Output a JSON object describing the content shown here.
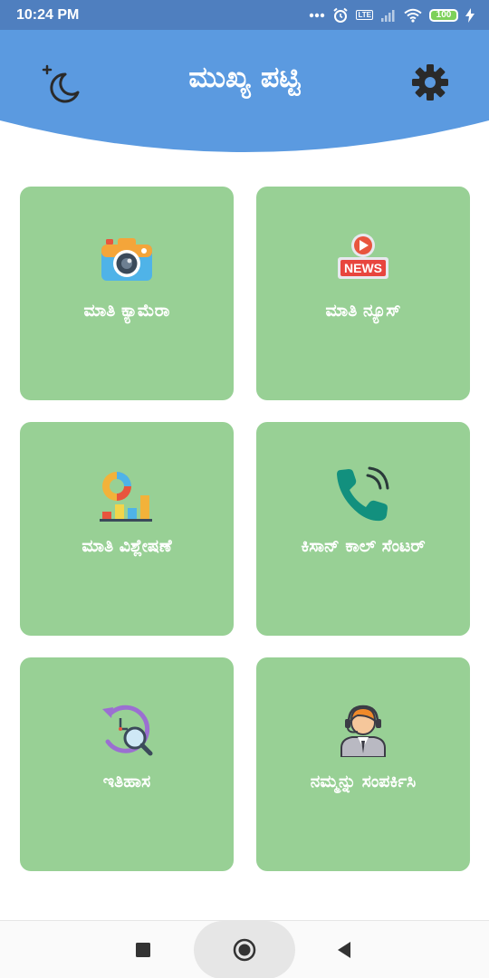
{
  "status_bar": {
    "time": "10:24 PM",
    "battery": "100",
    "network": "LTE"
  },
  "header": {
    "title": "ಮುಖ್ಯ ಪಟ್ಟಿ"
  },
  "menu": {
    "items": [
      {
        "label": "ಮಾತಿ ಕ್ಯಾಮೆರಾ",
        "icon": "camera-icon"
      },
      {
        "label": "ಮಾತಿ ನ್ಯೂಸ್",
        "icon": "news-icon"
      },
      {
        "label": "ಮಾತಿ ವಿಶ್ಲೇಷಣೆ",
        "icon": "analytics-icon"
      },
      {
        "label": "ಕಿಸಾನ್ ಕಾಲ್ ಸೆಂಟರ್",
        "icon": "phone-call-icon"
      },
      {
        "label": "ಇತಿಹಾಸ",
        "icon": "history-icon"
      },
      {
        "label": "ನಮ್ಮನ್ನು ಸಂಪರ್ಕಿಸಿ",
        "icon": "support-agent-icon"
      }
    ]
  },
  "colors": {
    "header": "#5b9ae0",
    "status_bar": "#4f7fbf",
    "card": "#98d095",
    "background": "#ffffff"
  }
}
